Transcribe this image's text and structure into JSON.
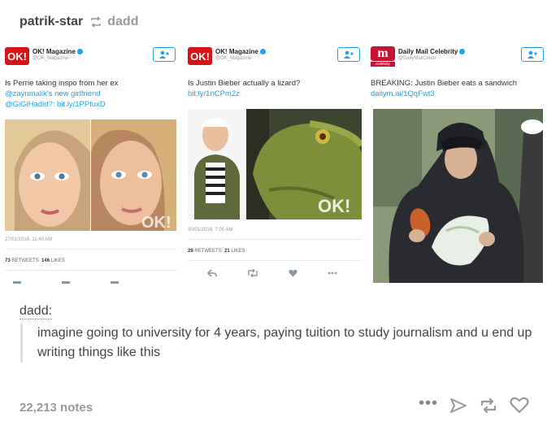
{
  "post": {
    "username": "patrik-star",
    "reblogged_from": "dadd",
    "caption_author": "dadd:",
    "caption_text": "imagine going to university for 4 years, paying tuition to study journalism and u end up writing things like this",
    "notes": "22,213 notes"
  },
  "tweets": [
    {
      "logo": "OK!",
      "name": "OK! Magazine",
      "handle": "@OK_Magazine",
      "text": "Is Perrie taking inspo from her ex",
      "link1": "@zaynmalik's new girlfriend",
      "link2": "@GiGiHadid?: bit.ly/1PPfuxD",
      "date": "27/01/2016, 11:40 AM",
      "retweets_count": "73",
      "retweets_label": "RETWEETS",
      "likes_count": "146",
      "likes_label": "LIKES",
      "photo_watermark": "OK!"
    },
    {
      "logo": "OK!",
      "name": "OK! Magazine",
      "handle": "@OK_Magazine",
      "text": "Is Justin Bieber actually a lizard?",
      "link1": "bit.ly/1nCPm2z",
      "date": "30/01/2016, 7:05 AM",
      "retweets_count": "29",
      "retweets_label": "RETWEETS",
      "likes_count": "21",
      "likes_label": "LIKES",
      "photo_watermark": "OK!"
    },
    {
      "logo": "m",
      "name": "Daily Mail Celebrity",
      "handle": "@DailyMailCeleb",
      "badge": "Celebrity",
      "text": "BREAKING: Justin Bieber eats a sandwich",
      "link1": "dailym.ai/1QqFwt3"
    }
  ],
  "colors": {
    "twitter_blue": "#1da1f2",
    "ok_red": "#d7141a",
    "dailymail_red": "#c41432",
    "notes_gray": "#999999"
  },
  "icons": [
    "reblog-icon",
    "follow-icon",
    "reply-icon",
    "retweet-icon",
    "like-icon",
    "more-icon",
    "share-icon",
    "heart-icon",
    "verified-icon"
  ]
}
